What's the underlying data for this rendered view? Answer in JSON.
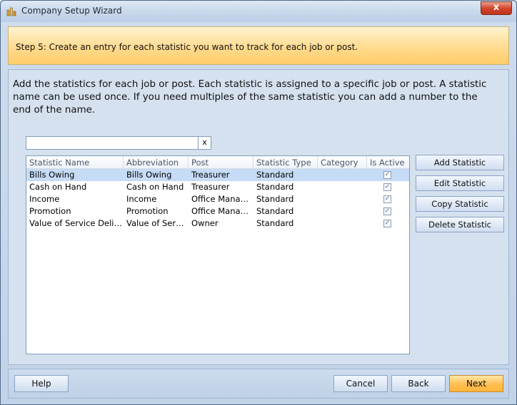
{
  "window": {
    "title": "Company Setup Wizard",
    "close_label": "x"
  },
  "step_banner": {
    "text": "Step 5: Create an entry for each statistic you want to track for each job or post."
  },
  "intro": {
    "text": "Add the statistics for each job or post. Each statistic is assigned to a specific job or post. A statistic name can be used once. If you need multiples of the same statistic you can add a number to the end of the name."
  },
  "search": {
    "value": "",
    "clear_label": "x"
  },
  "grid": {
    "columns": [
      "Statistic Name",
      "Abbreviation",
      "Post",
      "Statistic Type",
      "Category",
      "Is Active"
    ],
    "rows": [
      {
        "name": "Bills Owing",
        "abbr": "Bills Owing",
        "post": "Treasurer",
        "type": "Standard",
        "category": "",
        "active": true,
        "selected": true
      },
      {
        "name": "Cash on Hand",
        "abbr": "Cash on Hand",
        "post": "Treasurer",
        "type": "Standard",
        "category": "",
        "active": true,
        "selected": false
      },
      {
        "name": "Income",
        "abbr": "Income",
        "post": "Office Manager",
        "type": "Standard",
        "category": "",
        "active": true,
        "selected": false
      },
      {
        "name": "Promotion",
        "abbr": "Promotion",
        "post": "Office Manager",
        "type": "Standard",
        "category": "",
        "active": true,
        "selected": false
      },
      {
        "name": "Value of Service Delivered",
        "abbr": "Value of Servic...",
        "post": "Owner",
        "type": "Standard",
        "category": "",
        "active": true,
        "selected": false
      }
    ]
  },
  "side_buttons": {
    "add": "Add Statistic",
    "edit": "Edit Statistic",
    "copy": "Copy Statistic",
    "delete": "Delete Statistic"
  },
  "footer": {
    "help": "Help",
    "cancel": "Cancel",
    "back": "Back",
    "next": "Next"
  },
  "colors": {
    "banner": "#ffd98a",
    "selected_row": "#c6dbf5",
    "next_button": "#ffbf52",
    "close_button": "#d2462c"
  }
}
